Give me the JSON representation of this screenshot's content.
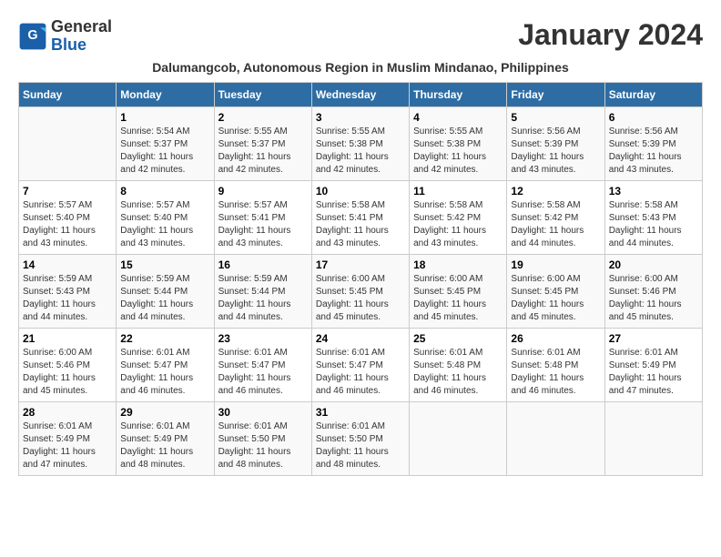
{
  "header": {
    "logo_line1": "General",
    "logo_line2": "Blue",
    "title": "January 2024",
    "subtitle": "Dalumangcob, Autonomous Region in Muslim Mindanao, Philippines"
  },
  "columns": [
    "Sunday",
    "Monday",
    "Tuesday",
    "Wednesday",
    "Thursday",
    "Friday",
    "Saturday"
  ],
  "weeks": [
    [
      {
        "day": "",
        "info": ""
      },
      {
        "day": "1",
        "info": "Sunrise: 5:54 AM\nSunset: 5:37 PM\nDaylight: 11 hours\nand 42 minutes."
      },
      {
        "day": "2",
        "info": "Sunrise: 5:55 AM\nSunset: 5:37 PM\nDaylight: 11 hours\nand 42 minutes."
      },
      {
        "day": "3",
        "info": "Sunrise: 5:55 AM\nSunset: 5:38 PM\nDaylight: 11 hours\nand 42 minutes."
      },
      {
        "day": "4",
        "info": "Sunrise: 5:55 AM\nSunset: 5:38 PM\nDaylight: 11 hours\nand 42 minutes."
      },
      {
        "day": "5",
        "info": "Sunrise: 5:56 AM\nSunset: 5:39 PM\nDaylight: 11 hours\nand 43 minutes."
      },
      {
        "day": "6",
        "info": "Sunrise: 5:56 AM\nSunset: 5:39 PM\nDaylight: 11 hours\nand 43 minutes."
      }
    ],
    [
      {
        "day": "7",
        "info": "Sunrise: 5:57 AM\nSunset: 5:40 PM\nDaylight: 11 hours\nand 43 minutes."
      },
      {
        "day": "8",
        "info": "Sunrise: 5:57 AM\nSunset: 5:40 PM\nDaylight: 11 hours\nand 43 minutes."
      },
      {
        "day": "9",
        "info": "Sunrise: 5:57 AM\nSunset: 5:41 PM\nDaylight: 11 hours\nand 43 minutes."
      },
      {
        "day": "10",
        "info": "Sunrise: 5:58 AM\nSunset: 5:41 PM\nDaylight: 11 hours\nand 43 minutes."
      },
      {
        "day": "11",
        "info": "Sunrise: 5:58 AM\nSunset: 5:42 PM\nDaylight: 11 hours\nand 43 minutes."
      },
      {
        "day": "12",
        "info": "Sunrise: 5:58 AM\nSunset: 5:42 PM\nDaylight: 11 hours\nand 44 minutes."
      },
      {
        "day": "13",
        "info": "Sunrise: 5:58 AM\nSunset: 5:43 PM\nDaylight: 11 hours\nand 44 minutes."
      }
    ],
    [
      {
        "day": "14",
        "info": "Sunrise: 5:59 AM\nSunset: 5:43 PM\nDaylight: 11 hours\nand 44 minutes."
      },
      {
        "day": "15",
        "info": "Sunrise: 5:59 AM\nSunset: 5:44 PM\nDaylight: 11 hours\nand 44 minutes."
      },
      {
        "day": "16",
        "info": "Sunrise: 5:59 AM\nSunset: 5:44 PM\nDaylight: 11 hours\nand 44 minutes."
      },
      {
        "day": "17",
        "info": "Sunrise: 6:00 AM\nSunset: 5:45 PM\nDaylight: 11 hours\nand 45 minutes."
      },
      {
        "day": "18",
        "info": "Sunrise: 6:00 AM\nSunset: 5:45 PM\nDaylight: 11 hours\nand 45 minutes."
      },
      {
        "day": "19",
        "info": "Sunrise: 6:00 AM\nSunset: 5:45 PM\nDaylight: 11 hours\nand 45 minutes."
      },
      {
        "day": "20",
        "info": "Sunrise: 6:00 AM\nSunset: 5:46 PM\nDaylight: 11 hours\nand 45 minutes."
      }
    ],
    [
      {
        "day": "21",
        "info": "Sunrise: 6:00 AM\nSunset: 5:46 PM\nDaylight: 11 hours\nand 45 minutes."
      },
      {
        "day": "22",
        "info": "Sunrise: 6:01 AM\nSunset: 5:47 PM\nDaylight: 11 hours\nand 46 minutes."
      },
      {
        "day": "23",
        "info": "Sunrise: 6:01 AM\nSunset: 5:47 PM\nDaylight: 11 hours\nand 46 minutes."
      },
      {
        "day": "24",
        "info": "Sunrise: 6:01 AM\nSunset: 5:47 PM\nDaylight: 11 hours\nand 46 minutes."
      },
      {
        "day": "25",
        "info": "Sunrise: 6:01 AM\nSunset: 5:48 PM\nDaylight: 11 hours\nand 46 minutes."
      },
      {
        "day": "26",
        "info": "Sunrise: 6:01 AM\nSunset: 5:48 PM\nDaylight: 11 hours\nand 46 minutes."
      },
      {
        "day": "27",
        "info": "Sunrise: 6:01 AM\nSunset: 5:49 PM\nDaylight: 11 hours\nand 47 minutes."
      }
    ],
    [
      {
        "day": "28",
        "info": "Sunrise: 6:01 AM\nSunset: 5:49 PM\nDaylight: 11 hours\nand 47 minutes."
      },
      {
        "day": "29",
        "info": "Sunrise: 6:01 AM\nSunset: 5:49 PM\nDaylight: 11 hours\nand 48 minutes."
      },
      {
        "day": "30",
        "info": "Sunrise: 6:01 AM\nSunset: 5:50 PM\nDaylight: 11 hours\nand 48 minutes."
      },
      {
        "day": "31",
        "info": "Sunrise: 6:01 AM\nSunset: 5:50 PM\nDaylight: 11 hours\nand 48 minutes."
      },
      {
        "day": "",
        "info": ""
      },
      {
        "day": "",
        "info": ""
      },
      {
        "day": "",
        "info": ""
      }
    ]
  ]
}
